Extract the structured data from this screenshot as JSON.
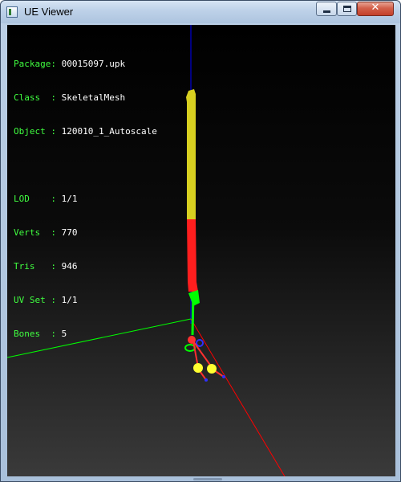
{
  "window": {
    "title": "UE Viewer",
    "controls": {
      "minimize": "minimize",
      "maximize": "maximize",
      "close": "✕"
    }
  },
  "info_panel": {
    "sep": ":",
    "rows": [
      {
        "label": "Package",
        "value": "00015097.upk"
      },
      {
        "label": "Class  ",
        "value": "SkeletalMesh"
      },
      {
        "label": "Object ",
        "value": "120010_1_Autoscale"
      }
    ],
    "stats": [
      {
        "label": "LOD    ",
        "value": "1/1"
      },
      {
        "label": "Verts  ",
        "value": "770"
      },
      {
        "label": "Tris   ",
        "value": "946"
      },
      {
        "label": "UV Set ",
        "value": "1/1"
      },
      {
        "label": "Bones  ",
        "value": "5"
      }
    ]
  },
  "colors": {
    "info_label": "#40ff40",
    "info_value": "#ffffff",
    "axis_x": "#ff0000",
    "axis_y": "#00ff00",
    "axis_z": "#0000ff",
    "mesh_upper": "#d8d020",
    "mesh_lower": "#ff1e1e",
    "bone_line": "#00ff00",
    "joint": "#ffff30"
  },
  "icons": [
    "app-icon",
    "minimize-icon",
    "maximize-icon",
    "close-icon"
  ]
}
